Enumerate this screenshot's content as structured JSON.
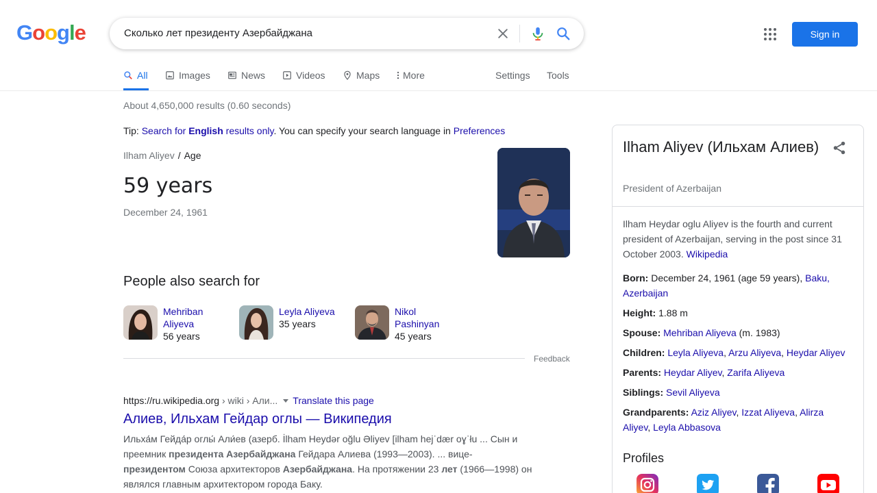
{
  "header": {
    "logo": [
      "G",
      "o",
      "o",
      "g",
      "l",
      "e"
    ],
    "query": "Сколько лет президенту Азербайджана",
    "signin_label": "Sign in"
  },
  "tabs": {
    "all": "All",
    "images": "Images",
    "news": "News",
    "videos": "Videos",
    "maps": "Maps",
    "more": "More",
    "settings": "Settings",
    "tools": "Tools"
  },
  "stats": "About 4,650,000 results (0.60 seconds)",
  "tip": {
    "prefix": "Tip: ",
    "link_pre": "Search for ",
    "link_bold": "English",
    "link_post": " results only",
    "middle": ". You can specify your search language in ",
    "prefs": "Preferences"
  },
  "answer": {
    "crumb_entity": "Ilham Aliyev",
    "crumb_sep": "/",
    "crumb_attr": "Age",
    "value": "59 years",
    "date": "December 24, 1961"
  },
  "people_also_search": {
    "title": "People also search for",
    "items": [
      {
        "name_line1": "Mehriban",
        "name_line2": "Aliyeva",
        "years": "56 years"
      },
      {
        "name_line1": "Leyla Aliyeva",
        "name_line2": "",
        "years": "35 years"
      },
      {
        "name_line1": "Nikol",
        "name_line2": "Pashinyan",
        "years": "45 years"
      }
    ],
    "feedback": "Feedback"
  },
  "result": {
    "url_host": "https://ru.wikipedia.org",
    "url_path": " › wiki › Али...",
    "translate": "Translate this page",
    "title": "Алиев, Ильхам Гейдар оглы — Википедия",
    "s1": "Ильха́м Гейда́р оглы́ Али́ев (азерб. İlham Heydər oğlu Əliyev [ilham hejˈdær oɣˈłu ... Сын и преемник ",
    "s1b": "президента Азербайджана",
    "s2": " Гейдара Алиева (1993—2003). ... вице-",
    "s2b": "президентом",
    "s3": " Союза архитекторов ",
    "s3b": "Азербайджана",
    "s4": ". На протяжении 23 ",
    "s4b": "лет",
    "s5": " (1966—1998) он являлся главным архитектором города Баку."
  },
  "knowledge_panel": {
    "title": "Ilham Aliyev (Ильхам Алиев)",
    "subtitle": "President of Azerbaijan",
    "description": "Ilham Heydar oglu Aliyev is the fourth and current president of Azerbaijan, serving in the post since 31 October 2003. ",
    "description_link": "Wikipedia",
    "born_label": "Born:",
    "born_value": " December 24, 1961 (age 59 years), ",
    "born_link": "Baku, Azerbaijan",
    "height_label": "Height:",
    "height_value": " 1.88 m",
    "spouse_label": "Spouse:",
    "spouse_link": "Mehriban Aliyeva",
    "spouse_value": " (m. 1983)",
    "children_label": "Children:",
    "children_links": [
      "Leyla Aliyeva",
      "Arzu Aliyeva",
      "Heydar Aliyev"
    ],
    "parents_label": "Parents:",
    "parents_links": [
      "Heydar Aliyev",
      "Zarifa Aliyeva"
    ],
    "siblings_label": "Siblings:",
    "siblings_link": "Sevil Aliyeva",
    "grandparents_label": "Grandparents:",
    "grandparents_links": [
      "Aziz Aliyev",
      "Izzat Aliyeva",
      "Alirza Aliyev",
      "Leyla Abbasova"
    ],
    "profiles_title": "Profiles",
    "profiles": [
      "instagram-icon",
      "twitter-icon",
      "facebook-icon",
      "youtube-icon"
    ]
  },
  "colors": {
    "link": "#1a0dab",
    "accent": "#1a73e8",
    "muted": "#70757a"
  }
}
